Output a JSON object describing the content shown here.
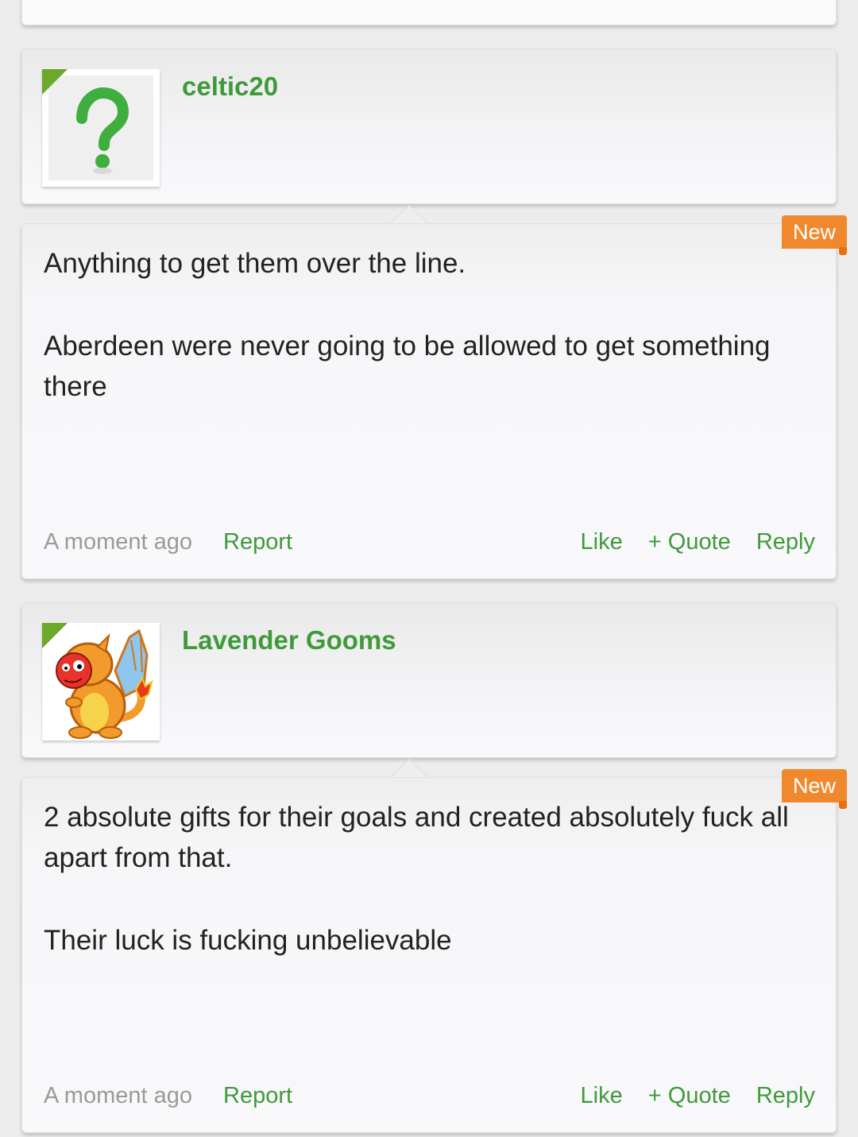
{
  "posts": [
    {
      "username": "celtic20",
      "avatar": "question-mark-placeholder",
      "badge": "New",
      "paragraphs": [
        "Anything to get them over the line.",
        "Aberdeen were never going to be allowed to get something there"
      ],
      "timestamp": "A moment ago",
      "report": "Report",
      "like": "Like",
      "quote": "+ Quote",
      "reply": "Reply"
    },
    {
      "username": "Lavender Gooms",
      "avatar": "orange-dragon-avatar",
      "badge": "New",
      "paragraphs": [
        "2 absolute gifts for their goals and created absolutely fuck all apart from that.",
        "Their luck is fucking unbelievable"
      ],
      "timestamp": "A moment ago",
      "report": "Report",
      "like": "Like",
      "quote": "+ Quote",
      "reply": "Reply"
    }
  ],
  "colors": {
    "accent_green": "#3f9a3a",
    "badge_orange": "#f0892e",
    "muted_text": "#9a9a9a"
  }
}
